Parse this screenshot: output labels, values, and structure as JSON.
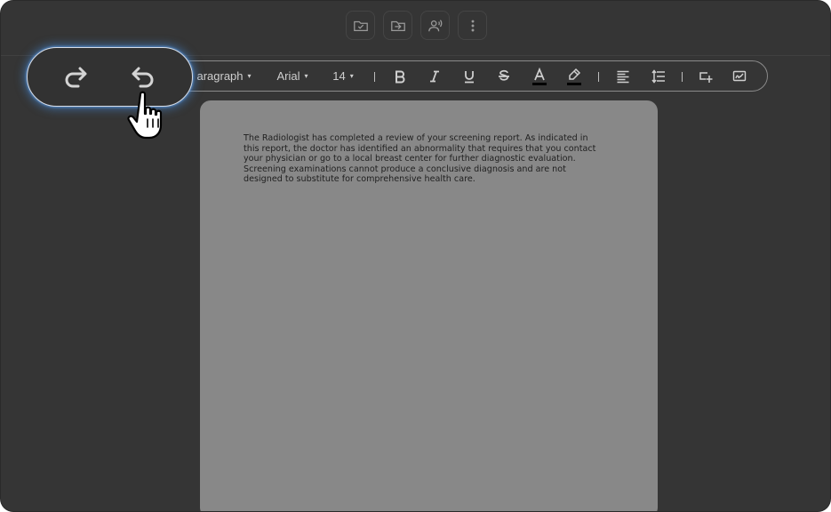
{
  "top_actions": [
    {
      "name": "folder-check-icon"
    },
    {
      "name": "folder-import-icon"
    },
    {
      "name": "voice-icon"
    },
    {
      "name": "more-vertical-icon"
    }
  ],
  "history": {
    "redo_icon": "redo-icon",
    "undo_icon": "undo-icon"
  },
  "toolbar": {
    "block_style": "aragraph",
    "font_family": "Arial",
    "font_size": "14",
    "caret": "▾",
    "icons": [
      "bold-icon",
      "italic-icon",
      "underline-icon",
      "strikethrough-icon",
      "text-color-icon",
      "highlight-icon",
      "align-left-icon",
      "line-spacing-icon",
      "insert-field-icon",
      "signature-icon"
    ],
    "text_color": "#000000",
    "highlight_color": "#000000"
  },
  "document": {
    "body": "The Radiologist has completed a review of your screening report. As indicated in this report, the doctor has identified an abnormality that requires that you contact your physician or go to a local breast center for further diagnostic evaluation. Screening examinations cannot produce a conclusive diagnosis and are not designed to substitute for comprehensive health care."
  },
  "colors": {
    "background": "#353535",
    "page": "#888888",
    "glow": "#468cdc"
  }
}
